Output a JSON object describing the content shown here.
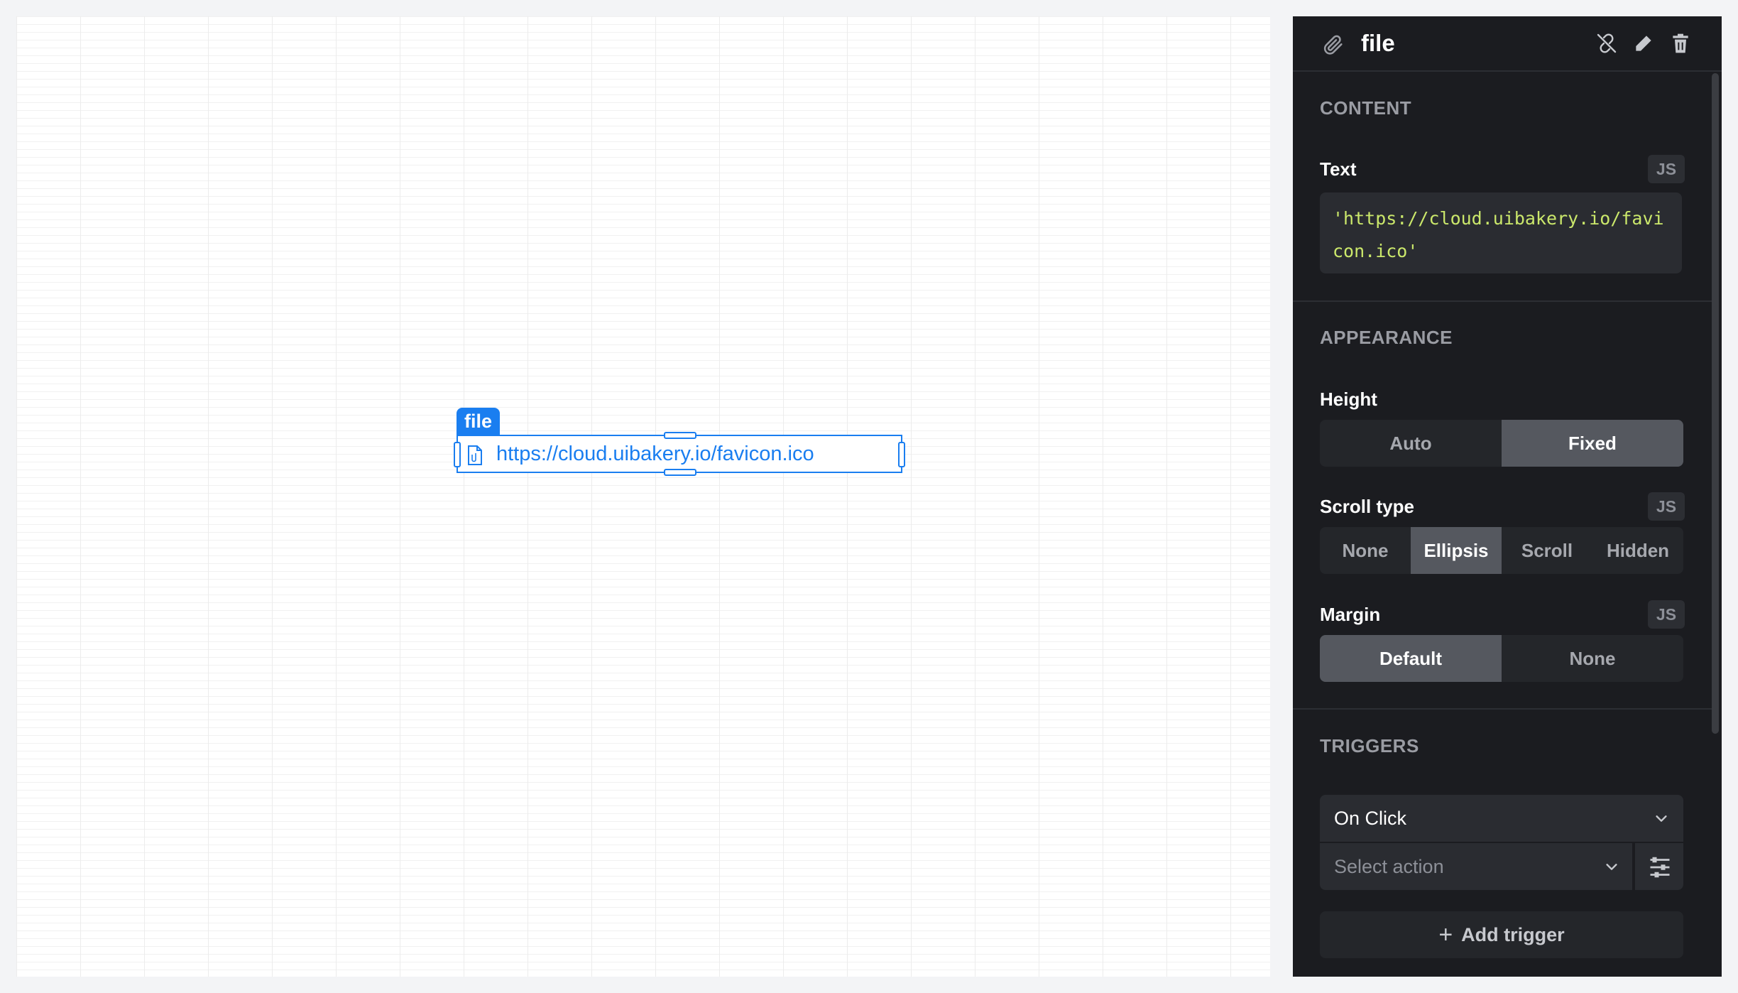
{
  "canvas": {
    "widget": {
      "tag": "file",
      "link_text": "https://cloud.uibakery.io/favicon.ico"
    }
  },
  "panel": {
    "title": "file",
    "title_icon": "paperclip-icon",
    "header_actions": [
      "unlink-icon",
      "pencil-icon",
      "trash-icon"
    ],
    "content": {
      "section_title": "CONTENT",
      "text_label": "Text",
      "js_badge": "JS",
      "text_value": "'https://cloud.uibakery.io/favicon.ico'"
    },
    "appearance": {
      "section_title": "APPEARANCE",
      "height_label": "Height",
      "height_options": [
        "Auto",
        "Fixed"
      ],
      "height_selected": "Fixed",
      "scroll_label": "Scroll type",
      "scroll_js": "JS",
      "scroll_options": [
        "None",
        "Ellipsis",
        "Scroll",
        "Hidden"
      ],
      "scroll_selected": "Ellipsis",
      "margin_label": "Margin",
      "margin_js": "JS",
      "margin_options": [
        "Default",
        "None"
      ],
      "margin_selected": "Default"
    },
    "triggers": {
      "section_title": "TRIGGERS",
      "trigger_value": "On Click",
      "action_placeholder": "Select action",
      "add_trigger_label": "Add trigger",
      "add_trigger_plus": "+"
    }
  },
  "colors": {
    "accent": "#1a7ef0",
    "panel_bg": "#1b1c20",
    "code_text": "#cbe86b"
  }
}
